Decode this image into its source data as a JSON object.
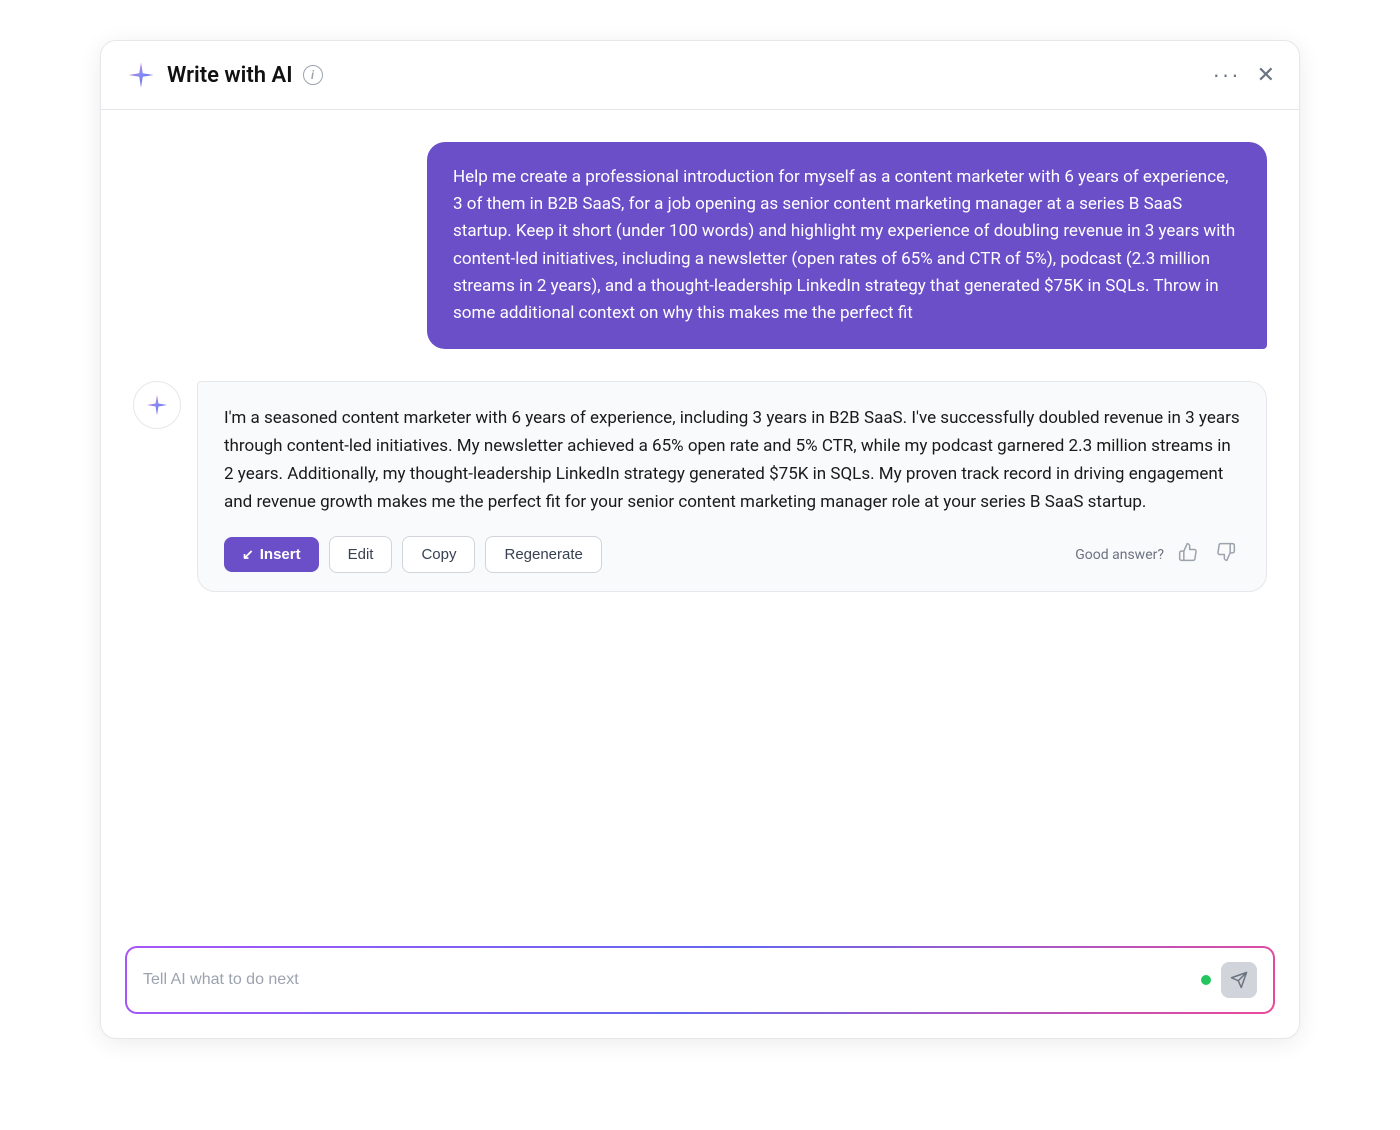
{
  "header": {
    "title": "Write with AI",
    "info_label": "i",
    "dots_label": "···",
    "close_label": "✕"
  },
  "user_message": {
    "text": "Help me create a professional introduction for myself as a content marketer with 6 years of experience, 3 of them in B2B SaaS, for a job opening as senior content marketing manager at a series B SaaS startup. Keep it short (under 100 words) and highlight my experience of doubling revenue in 3 years with content-led initiatives, including a newsletter (open rates of 65% and CTR of 5%), podcast (2.3 million streams in 2 years), and a thought-leadership LinkedIn strategy that generated $75K in SQLs. Throw in some additional context on why this makes me the perfect fit"
  },
  "ai_message": {
    "text": "I'm a seasoned content marketer with 6 years of experience, including 3 years in B2B SaaS. I've successfully doubled revenue in 3 years through content-led initiatives. My newsletter achieved a 65% open rate and 5% CTR, while my podcast garnered 2.3 million streams in 2 years. Additionally, my thought-leadership LinkedIn strategy generated $75K in SQLs. My proven track record in driving engagement and revenue growth makes me the perfect fit for your senior content marketing manager role at your series B SaaS startup."
  },
  "action_buttons": {
    "insert_label": "Insert",
    "insert_arrow": "↙",
    "edit_label": "Edit",
    "copy_label": "Copy",
    "regenerate_label": "Regenerate"
  },
  "feedback": {
    "label": "Good answer?",
    "thumbs_up": "👍",
    "thumbs_down": "👎"
  },
  "input": {
    "placeholder": "Tell AI what to do next"
  }
}
